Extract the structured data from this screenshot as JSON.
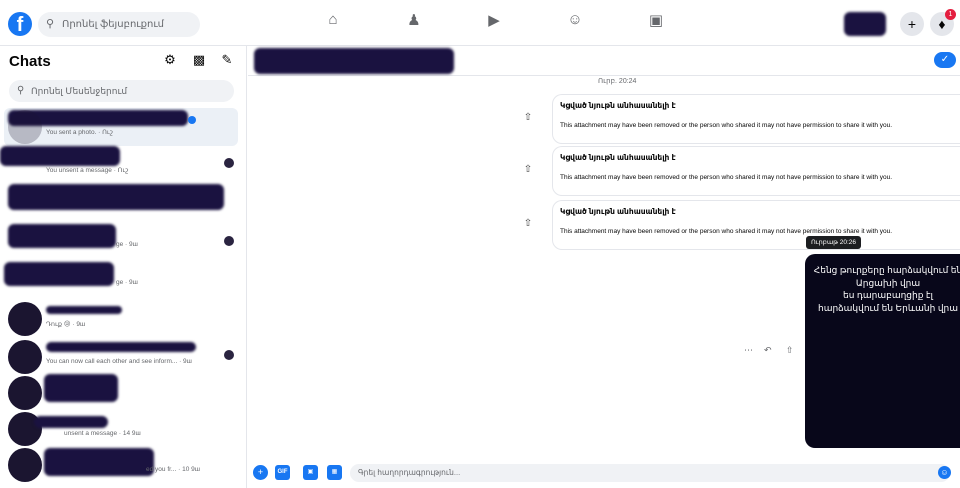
{
  "topbar": {
    "logo": "f",
    "search_placeholder": "Որոնել ֆեյսբուքում",
    "nav_icons": [
      "home-icon",
      "friends-icon",
      "watch-icon",
      "groups-icon",
      "gaming-icon"
    ],
    "notification_count": "1"
  },
  "sidebar": {
    "title": "Chats",
    "search_placeholder": "Որոնել Մեսենջերում",
    "chats": [
      {
        "preview": "You sent a photo. · Ուշ"
      },
      {
        "preview": "You unsent a message · Ուշ"
      },
      {
        "preview": ""
      },
      {
        "preview": "ge · 9ш"
      },
      {
        "preview": "ge · 9ш"
      },
      {
        "preview": "Դուք 😢 · 9ш"
      },
      {
        "preview": "You can now call each other and see inform... · 9ш"
      },
      {
        "preview": ""
      },
      {
        "preview": "unsent a message · 14 9ш"
      },
      {
        "preview": "ed you fr... · 10 9ш"
      }
    ]
  },
  "conversation": {
    "timestamp": "Ուրբ. 20:24",
    "attachments": [
      {
        "title": "Կցված նյութն անհասանելի է",
        "body": "This attachment may have been removed or the person who shared it may not have permission to share it with you."
      },
      {
        "title": "Կցված նյութն անհասանելի է",
        "body": "This attachment may have been removed or the person who shared it may not have permission to share it with you."
      },
      {
        "title": "Կցված նյութն անհասանելի է",
        "body": "This attachment may have been removed or the person who shared it may not have permission to share it with you."
      }
    ],
    "tooltip": "Ուրբաթ 20:26",
    "image_text": "Հենց թուրքերը հարձակվում են Արցախի վրա\nես դարաբաղցիք էլ հարձակվում են Երևանի վրա",
    "composer_placeholder": "Գրել հաղորդագրություն...",
    "gif_label": "GIF"
  }
}
